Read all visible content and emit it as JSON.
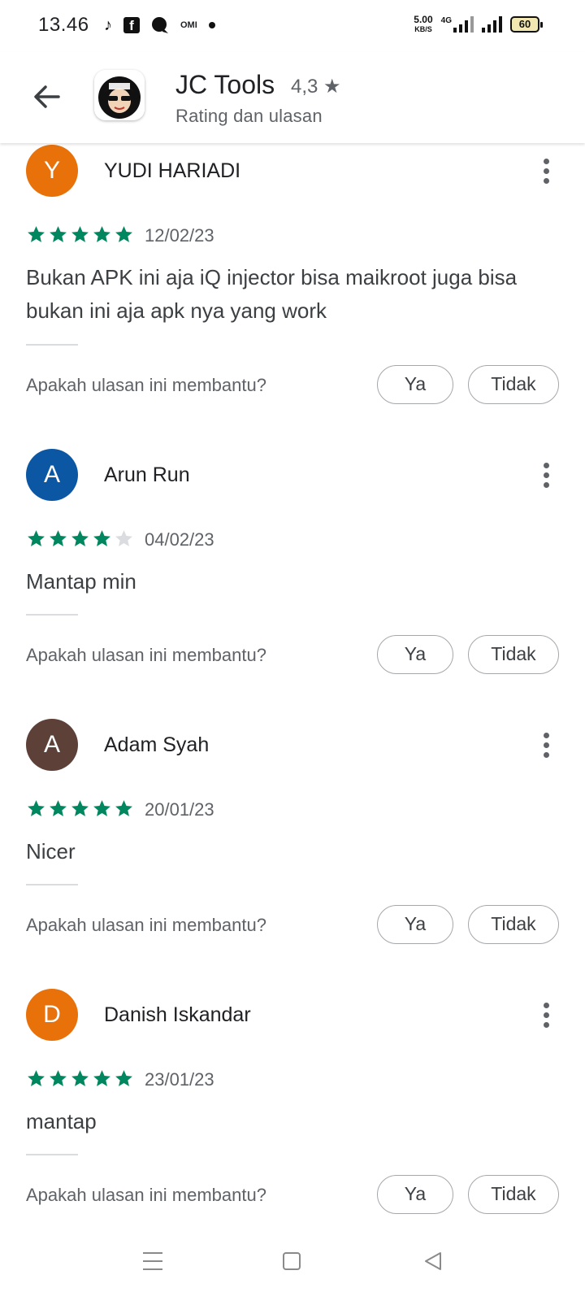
{
  "status_bar": {
    "time": "13.46",
    "icons": [
      "music-note-icon",
      "facebook-icon",
      "chat-bubble-icon",
      "omi-icon",
      "dot-icon"
    ],
    "omi_label": "OMI",
    "speed_value": "5.00",
    "speed_unit": "KB/S",
    "network": "4G",
    "battery": "60"
  },
  "app_bar": {
    "title": "JC Tools",
    "rating": "4,3 ★",
    "subtitle": "Rating dan ulasan"
  },
  "reviews": [
    {
      "avatar_letter": "Y",
      "avatar_color": "#e8710a",
      "name": "YUDI HARIADI",
      "stars": 5,
      "date": "12/02/23",
      "text": "Bukan APK ini aja iQ injector bisa maikroot juga bisa bukan ini aja apk nya yang work",
      "helpful_prompt": "Apakah ulasan ini membantu?",
      "yes_label": "Ya",
      "no_label": "Tidak"
    },
    {
      "avatar_letter": "A",
      "avatar_color": "#0b57a4",
      "name": "Arun Run",
      "stars": 4,
      "date": "04/02/23",
      "text": "Mantap min",
      "helpful_prompt": "Apakah ulasan ini membantu?",
      "yes_label": "Ya",
      "no_label": "Tidak"
    },
    {
      "avatar_letter": "A",
      "avatar_color": "#5d4037",
      "name": "Adam Syah",
      "stars": 5,
      "date": "20/01/23",
      "text": "Nicer",
      "helpful_prompt": "Apakah ulasan ini membantu?",
      "yes_label": "Ya",
      "no_label": "Tidak"
    },
    {
      "avatar_letter": "D",
      "avatar_color": "#e8710a",
      "name": "Danish Iskandar",
      "stars": 5,
      "date": "23/01/23",
      "text": "mantap",
      "helpful_prompt": "Apakah ulasan ini membantu?",
      "yes_label": "Ya",
      "no_label": "Tidak"
    }
  ],
  "colors": {
    "star_filled": "#01875f",
    "star_empty": "#dadce0"
  },
  "nav_bar": {
    "icons": [
      "menu-icon",
      "home-square-icon",
      "back-triangle-icon"
    ]
  }
}
